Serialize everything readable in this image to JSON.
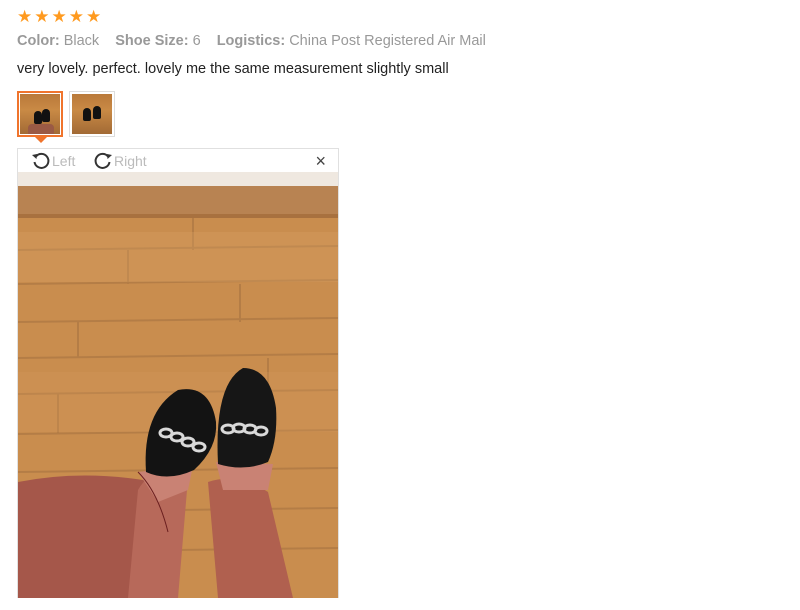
{
  "review": {
    "rating": 5,
    "stars": [
      "★",
      "★",
      "★",
      "★",
      "★"
    ],
    "attributes": [
      {
        "key": "Color:",
        "value": "Black"
      },
      {
        "key": "Shoe Size:",
        "value": "6"
      },
      {
        "key": "Logistics:",
        "value": "China Post Registered Air Mail"
      }
    ],
    "text": "very lovely. perfect. lovely me the same measurement slightly small"
  },
  "viewer": {
    "rotate_left_label": "Left",
    "rotate_right_label": "Right",
    "close_symbol": "×"
  },
  "colors": {
    "star": "#ff9a1f",
    "active_thumb_border": "#f0742c",
    "floor": "#c98d4e"
  }
}
